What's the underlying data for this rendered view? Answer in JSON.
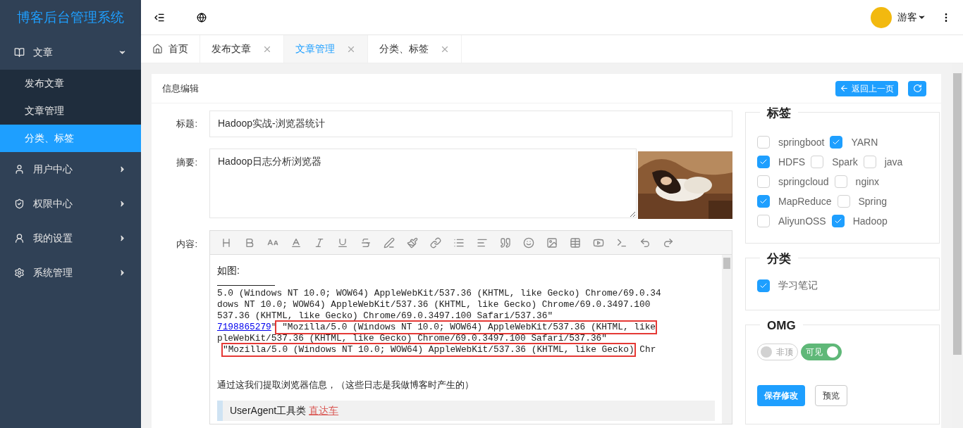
{
  "logo": "博客后台管理系统",
  "user": {
    "name": "游客"
  },
  "sidebar": {
    "items": [
      {
        "label": "文章",
        "expanded": true,
        "children": [
          {
            "label": "发布文章",
            "selected": false
          },
          {
            "label": "文章管理",
            "selected": false
          },
          {
            "label": "分类、标签",
            "selected": true
          }
        ]
      },
      {
        "label": "用户中心",
        "expanded": false
      },
      {
        "label": "权限中心",
        "expanded": false
      },
      {
        "label": "我的设置",
        "expanded": false
      },
      {
        "label": "系统管理",
        "expanded": false
      }
    ]
  },
  "tabs": [
    {
      "label": "首页",
      "selected": false,
      "closable": false
    },
    {
      "label": "发布文章",
      "selected": false,
      "closable": true
    },
    {
      "label": "文章管理",
      "selected": true,
      "closable": true
    },
    {
      "label": "分类、标签",
      "selected": false,
      "closable": true
    }
  ],
  "card": {
    "title": "信息编辑",
    "back_button": "返回上一页"
  },
  "form": {
    "title_label": "标题:",
    "title_value": "Hadoop实战-浏览器统计",
    "summary_label": "摘要:",
    "summary_value": "Hadoop日志分析浏览器",
    "content_label": "内容:"
  },
  "editor": {
    "intro": "如图:",
    "code_lines": [
      [
        {
          "text": "5.0 (Windows NT 10.0; WOW64) AppleWebKit/537.36 (KHTML, like Gecko) Chrome/69.0.34",
          "kind": "plain"
        }
      ],
      [
        {
          "text": "dows NT 10.0; WOW64) AppleWebKit/537.36 (KHTML, like Gecko) Chrome/69.0.3497.100",
          "kind": "plain"
        }
      ],
      [
        {
          "text": "537.36 (KHTML, like Gecko) Chrome/69.0.3497.100 Safari/537.36\"",
          "kind": "plain"
        }
      ],
      [
        {
          "text": "7198865279",
          "kind": "link"
        },
        {
          "text": "\"",
          "kind": "plain"
        },
        {
          "text": " \"Mozilla/5.0 (Windows NT 10.0; WOW64) AppleWebKit/537.36 (KHTML, like",
          "kind": "boxed"
        }
      ],
      [
        {
          "text": "pleWebKit/537.36 (KHTML, like Gecko) Chrome/69.0.3497.100 Safari/537.36\"",
          "kind": "plain"
        }
      ],
      [
        {
          "text": "\"Mozilla/5.0 (Windows NT 10.0; WOW64) AppleWebKit/537.36 (KHTML, like Gecko)",
          "kind": "boxed"
        },
        {
          "text": " Chr",
          "kind": "plain"
        }
      ]
    ],
    "paragraph": "通过这我们提取浏览器信息，（这些日志是我做博客时产生的）",
    "quote": {
      "text": "UserAgent工具类",
      "link": "直达车"
    }
  },
  "tags": {
    "title": "标签",
    "rows": [
      [
        {
          "label": "springboot",
          "checked": false
        },
        {
          "label": "YARN",
          "checked": true
        }
      ],
      [
        {
          "label": "HDFS",
          "checked": true
        },
        {
          "label": "Spark",
          "checked": false
        },
        {
          "label": "java",
          "checked": false
        }
      ],
      [
        {
          "label": "springcloud",
          "checked": false
        },
        {
          "label": "nginx",
          "checked": false
        }
      ],
      [
        {
          "label": "MapReduce",
          "checked": true
        },
        {
          "label": "Spring",
          "checked": false
        }
      ],
      [
        {
          "label": "AliyunOSS",
          "checked": false
        },
        {
          "label": "Hadoop",
          "checked": true
        }
      ]
    ]
  },
  "category": {
    "title": "分类",
    "items": [
      {
        "label": "学习笔记",
        "checked": true
      }
    ]
  },
  "omg": {
    "title": "OMG",
    "switches": [
      {
        "label": "非顶",
        "on": false
      },
      {
        "label": "可见",
        "on": true
      }
    ],
    "save_button": "保存修改",
    "preview_button": "预览"
  }
}
